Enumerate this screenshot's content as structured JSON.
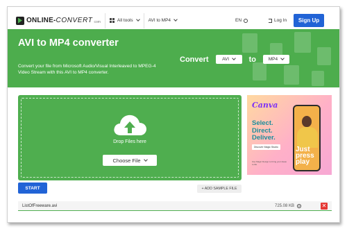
{
  "header": {
    "logo_main": "ONLINE-",
    "logo_convert": "CONVERT",
    "logo_suffix": "com",
    "nav_all_tools": "All tools",
    "nav_converter": "AVI to MP4",
    "language": "EN",
    "login": "Log In",
    "signup": "Sign Up"
  },
  "hero": {
    "title": "AVI to MP4 converter",
    "description": "Convert your file from Microsoft Audio/Visual Interleaved to MPEG-4 Video Stream with this AVI to MP4 converter.",
    "convert_label": "Convert",
    "from_format": "AVI",
    "to_label": "to",
    "to_format": "MP4"
  },
  "upload": {
    "drop_text": "Drop Files here",
    "choose_file": "Choose File"
  },
  "ad": {
    "brand": "Canva",
    "headline": "Select. Direct. Deliver.",
    "cta": "Discover Magic Studio",
    "phone_text": "Just press play",
    "small_print": "Use Magic Design to bring your ideas to life"
  },
  "actions": {
    "start": "START",
    "add_sample": "+ ADD SAMPLE FILE"
  },
  "file": {
    "name": "ListOfFreeware.avi",
    "size": "725.08 KB",
    "remove": "✕"
  },
  "colors": {
    "brand_green": "#4dad4d",
    "primary_blue": "#2163d6",
    "danger_red": "#e53935"
  }
}
